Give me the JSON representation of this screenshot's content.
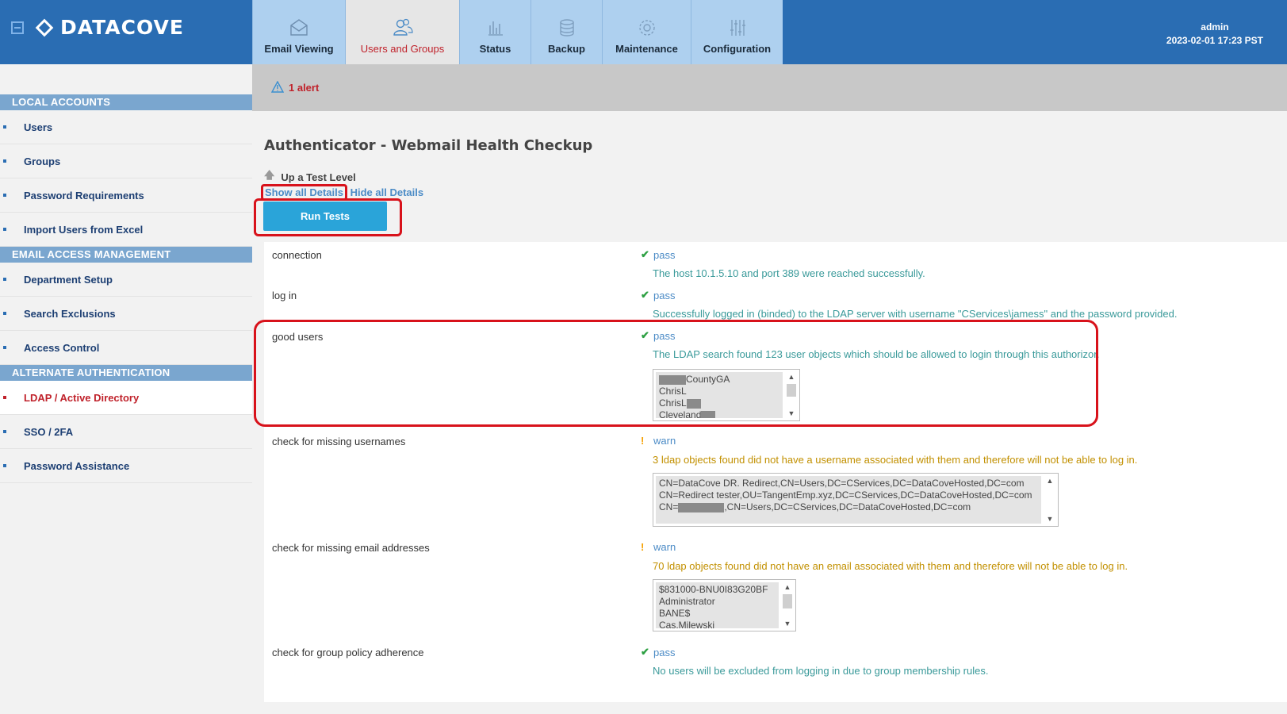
{
  "brand": {
    "name": "DATACOVE"
  },
  "tabs": [
    {
      "label": "Email Viewing",
      "icon": "envelope-icon"
    },
    {
      "label": "Users and Groups",
      "icon": "users-icon",
      "active": true
    },
    {
      "label": "Status",
      "icon": "bar-chart-icon"
    },
    {
      "label": "Backup",
      "icon": "database-icon"
    },
    {
      "label": "Maintenance",
      "icon": "gear-icon"
    },
    {
      "label": "Configuration",
      "icon": "sliders-icon"
    }
  ],
  "user": {
    "name": "admin",
    "datetime": "2023-02-01 17:23 PST"
  },
  "alert": {
    "text": "1 alert"
  },
  "sidebar": {
    "sections": [
      {
        "title": "LOCAL ACCOUNTS",
        "items": [
          "Users",
          "Groups",
          "Password Requirements",
          "Import Users from Excel"
        ]
      },
      {
        "title": "EMAIL ACCESS MANAGEMENT",
        "items": [
          "Department Setup",
          "Search Exclusions",
          "Access Control"
        ]
      },
      {
        "title": "ALTERNATE AUTHENTICATION",
        "items": [
          "LDAP / Active Directory",
          "SSO / 2FA",
          "Password Assistance"
        ]
      }
    ],
    "active_item": "LDAP / Active Directory"
  },
  "main": {
    "title": "Authenticator - Webmail Health Checkup",
    "up_level": "Up a Test Level",
    "show_all": "Show all Details",
    "hide_all": "Hide all Details",
    "run_tests": "Run Tests"
  },
  "tests": {
    "connection": {
      "name": "connection",
      "status": "pass",
      "message": "The host 10.1.5.10 and port 389 were reached successfully."
    },
    "login": {
      "name": "log in",
      "status": "pass",
      "message": "Successfully logged in (binded) to the LDAP server with username \"CServices\\jamess\" and the password provided."
    },
    "good_users": {
      "name": "good users",
      "status": "pass",
      "message": "The LDAP search found 123 user objects which should be allowed to login through this authorizor.",
      "list": [
        "CountyGA",
        "ChrisL",
        "ChrisL",
        "Cleveland"
      ]
    },
    "missing_usernames": {
      "name": "check for missing usernames",
      "status": "warn",
      "message": "3 ldap objects found did not have a username associated with them and therefore will not be able to log in.",
      "list": [
        "CN=DataCove DR. Redirect,CN=Users,DC=CServices,DC=DataCoveHosted,DC=com",
        "CN=Redirect tester,OU=TangentEmp.xyz,DC=CServices,DC=DataCoveHosted,DC=com",
        "CN=",
        ",CN=Users,DC=CServices,DC=DataCoveHosted,DC=com"
      ]
    },
    "missing_email": {
      "name": "check for missing email addresses",
      "status": "warn",
      "message": "70 ldap objects found did not have an email associated with them and therefore will not be able to log in.",
      "list": [
        "$831000-BNU0I83G20BF",
        "Administrator",
        "BANE$",
        "Cas.Milewski"
      ]
    },
    "group_policy": {
      "name": "check for group policy adherence",
      "status": "pass",
      "message": "No users will be excluded from logging in due to group membership rules."
    }
  }
}
